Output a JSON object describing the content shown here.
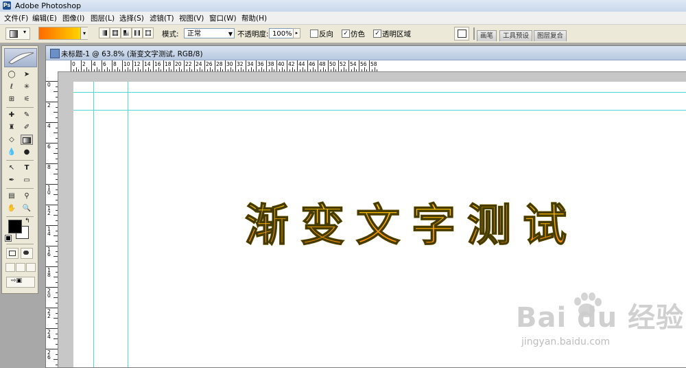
{
  "app": {
    "title": "Adobe Photoshop"
  },
  "menu": [
    "文件(F)",
    "编辑(E)",
    "图像(I)",
    "图层(L)",
    "选择(S)",
    "滤镜(T)",
    "视图(V)",
    "窗口(W)",
    "帮助(H)"
  ],
  "options": {
    "mode_label": "模式:",
    "mode_value": "正常",
    "opacity_label": "不透明度:",
    "opacity_value": "100%",
    "reverse_label": "反向",
    "dither_label": "仿色",
    "transparency_label": "透明区域",
    "reverse_checked": false,
    "dither_checked": true,
    "transparency_checked": true,
    "gradient_colors": [
      "#ff6a00",
      "#ffe600"
    ]
  },
  "palette_tabs": [
    "画笔",
    "工具预设",
    "图层复合"
  ],
  "document": {
    "title": "未标题-1 @ 63.8% (渐变文字测试, RGB/8)",
    "canvas_text": "渐变文字测试"
  },
  "rulers": {
    "horizontal": [
      "0",
      "2",
      "4",
      "6",
      "8",
      "10",
      "12",
      "14",
      "16",
      "18",
      "20",
      "22",
      "24",
      "26",
      "28",
      "30",
      "32",
      "34",
      "36",
      "38",
      "40",
      "42",
      "44",
      "46",
      "48",
      "50",
      "52",
      "54",
      "56",
      "58"
    ],
    "vertical": [
      "0",
      "2",
      "4",
      "6",
      "8",
      "10",
      "12",
      "14",
      "16",
      "18",
      "20",
      "22",
      "24",
      "26"
    ]
  },
  "colors": {
    "foreground": "#000000",
    "background": "#ffffff",
    "guide": "#52d6d6"
  },
  "watermark": {
    "logo": "Bai du 经验",
    "url": "jingyan.baidu.com"
  }
}
